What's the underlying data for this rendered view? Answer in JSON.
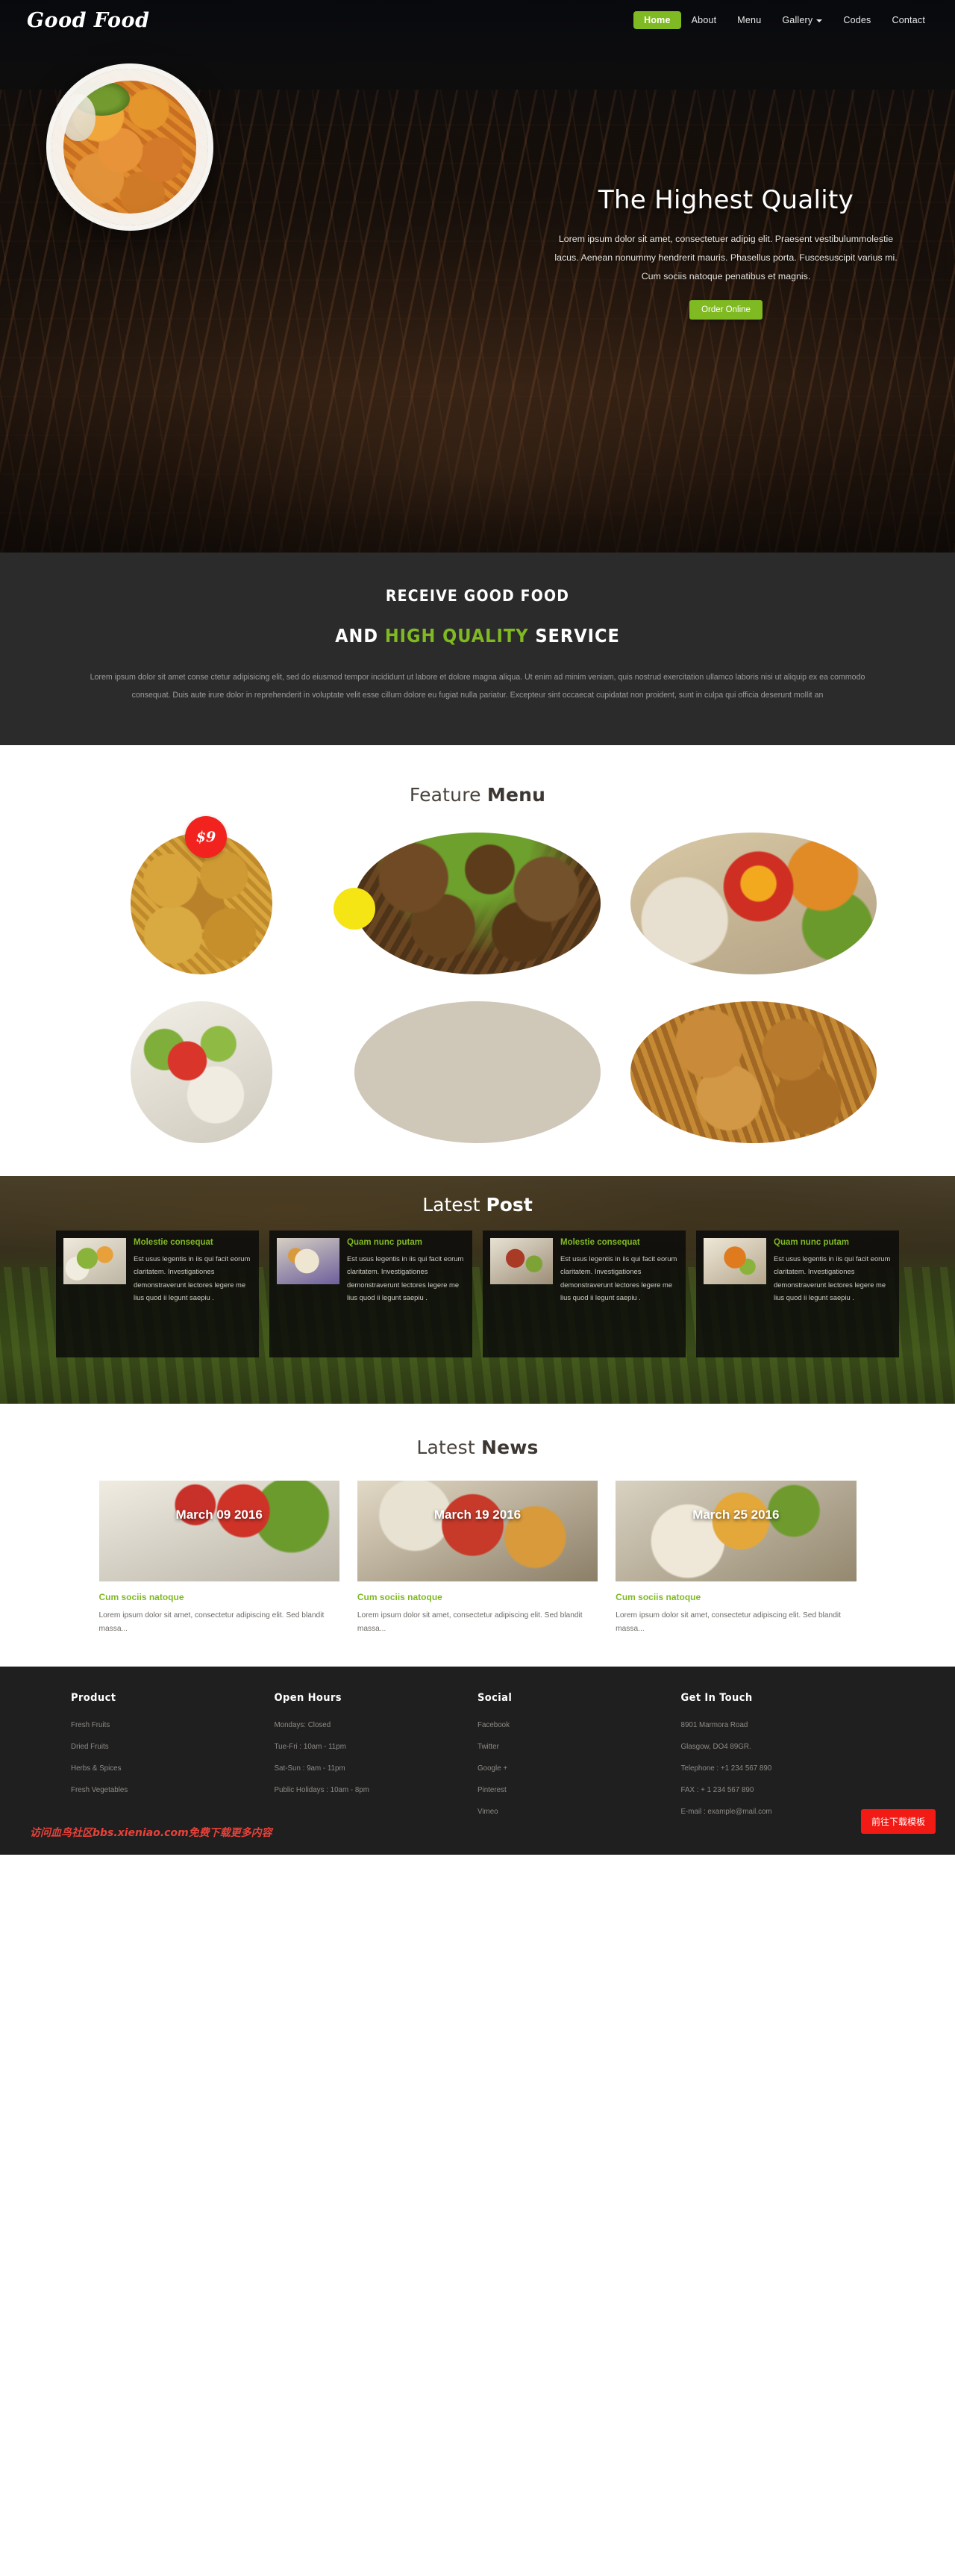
{
  "header": {
    "logo": "Good Food",
    "nav": [
      {
        "label": "Home",
        "active": true,
        "caret": false
      },
      {
        "label": "About",
        "active": false,
        "caret": false
      },
      {
        "label": "Menu",
        "active": false,
        "caret": false
      },
      {
        "label": "Gallery",
        "active": false,
        "caret": true
      },
      {
        "label": "Codes",
        "active": false,
        "caret": false
      },
      {
        "label": "Contact",
        "active": false,
        "caret": false
      }
    ]
  },
  "hero": {
    "title": "The Highest Quality",
    "text": "Lorem ipsum dolor sit amet, consectetuer adipig elit. Praesent vestibulummolestie lacus. Aenean nonummy hendrerit mauris. Phasellus porta. Fuscesuscipit varius mi. Cum sociis natoque penatibus et magnis.",
    "cta": "Order Online"
  },
  "band": {
    "line1": "RECEIVE GOOD FOOD",
    "line2_pre": "AND ",
    "line2_hl": "HIGH QUALITY",
    "line2_post": " SERVICE",
    "paragraph": "Lorem ipsum dolor sit amet conse ctetur adipisicing elit, sed do eiusmod tempor incididunt ut labore et dolore magna aliqua. Ut enim ad minim veniam, quis nostrud exercitation ullamco laboris nisi ut aliquip ex ea commodo consequat. Duis aute irure dolor in reprehenderit in voluptate velit esse cillum dolore eu fugiat nulla pariatur. Excepteur sint occaecat cupidatat non proident, sunt in culpa qui officia deserunt mollit an"
  },
  "feature": {
    "title_light": "Feature ",
    "title_bold": "Menu",
    "price_badge": "$9",
    "items": [
      {
        "name": "feature-item-1",
        "texture": "f1"
      },
      {
        "name": "feature-item-2",
        "texture": "f2"
      },
      {
        "name": "feature-item-3",
        "texture": "f3"
      },
      {
        "name": "feature-item-4",
        "texture": "f4"
      },
      {
        "name": "feature-item-5",
        "texture": "f5"
      },
      {
        "name": "feature-item-6",
        "texture": "f6"
      }
    ]
  },
  "latest_post": {
    "title_light": "Latest ",
    "title_bold": "Post",
    "cards": [
      {
        "heading": "Molestie consequat",
        "text": "Est usus legentis in iis qui facit eorum claritatem. Investigationes demonstraverunt lectores legere me lius quod ii legunt saepiu ."
      },
      {
        "heading": "Quam nunc putam",
        "text": "Est usus legentis in iis qui facit eorum claritatem. Investigationes demonstraverunt lectores legere me lius quod ii legunt saepiu ."
      },
      {
        "heading": "Molestie consequat",
        "text": "Est usus legentis in iis qui facit eorum claritatem. Investigationes demonstraverunt lectores legere me lius quod ii legunt saepiu ."
      },
      {
        "heading": "Quam nunc putam",
        "text": "Est usus legentis in iis qui facit eorum claritatem. Investigationes demonstraverunt lectores legere me lius quod ii legunt saepiu ."
      }
    ]
  },
  "latest_news": {
    "title_light": "Latest ",
    "title_bold": "News",
    "items": [
      {
        "date": "March 09 2016",
        "heading": "Cum sociis natoque",
        "text": "Lorem ipsum dolor sit amet, consectetur adipiscing elit. Sed blandit massa..."
      },
      {
        "date": "March 19 2016",
        "heading": "Cum sociis natoque",
        "text": "Lorem ipsum dolor sit amet, consectetur adipiscing elit. Sed blandit massa..."
      },
      {
        "date": "March 25 2016",
        "heading": "Cum sociis natoque",
        "text": "Lorem ipsum dolor sit amet, consectetur adipiscing elit. Sed blandit massa..."
      }
    ]
  },
  "footer": {
    "columns": [
      {
        "heading": "Product",
        "items": [
          "Fresh Fruits",
          "Dried Fruits",
          "Herbs & Spices",
          "Fresh Vegetables"
        ]
      },
      {
        "heading": "Open Hours",
        "items": [
          "Mondays: Closed",
          "Tue-Fri : 10am - 11pm",
          "Sat-Sun : 9am - 11pm",
          "Public Holidays : 10am - 8pm"
        ]
      },
      {
        "heading": "Social",
        "items": [
          "Facebook",
          "Twitter",
          "Google +",
          "Pinterest",
          "Vimeo"
        ]
      },
      {
        "heading": "Get In Touch",
        "items": [
          "8901 Marmora Road",
          "Glasgow, DO4 89GR.",
          "Telephone : +1 234 567 890",
          "FAX : + 1 234 567 890",
          "E-mail : example@mail.com"
        ]
      }
    ],
    "watermark": "访问血鸟社区bbs.xieniao.com免费下载更多内容",
    "download_button": "前往下载模板"
  },
  "colors": {
    "accent_green": "#7fba22",
    "badge_red": "#f2221f",
    "badge_yellow": "#f5e515",
    "band_bg": "#2b2b2b",
    "footer_bg": "#1f1f1f",
    "download_red": "#f21a14"
  }
}
